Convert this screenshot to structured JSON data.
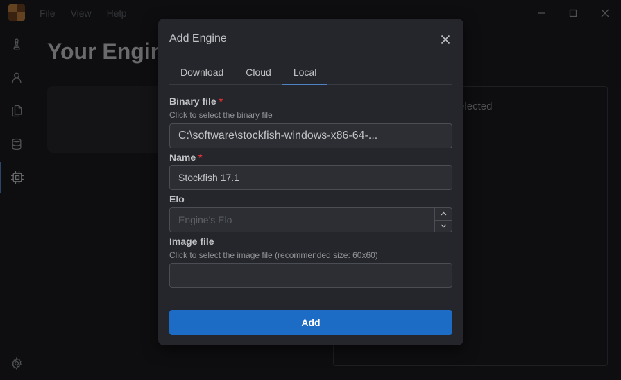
{
  "menu": {
    "items": [
      "File",
      "View",
      "Help"
    ]
  },
  "main": {
    "title": "Your Engines",
    "right_panel_text": "No engine selected"
  },
  "modal": {
    "title": "Add Engine",
    "tabs": [
      {
        "label": "Download",
        "active": false
      },
      {
        "label": "Cloud",
        "active": false
      },
      {
        "label": "Local",
        "active": true
      }
    ],
    "binary": {
      "label": "Binary file",
      "required_mark": "*",
      "description": "Click to select the binary file",
      "value": "C:\\software\\stockfish-windows-x86-64-..."
    },
    "name": {
      "label": "Name",
      "required_mark": "*",
      "value": "Stockfish 17.1"
    },
    "elo": {
      "label": "Elo",
      "placeholder": "Engine's Elo"
    },
    "image": {
      "label": "Image file",
      "description": "Click to select the image file (recommended size: 60x60)",
      "value": ""
    },
    "submit_label": "Add"
  },
  "sidebar": {
    "icons": [
      "chess-pawn-icon",
      "user-icon",
      "files-icon",
      "database-icon",
      "cpu-icon",
      "settings-icon"
    ],
    "active_index": 4
  },
  "colors": {
    "accent": "#1c6bc4",
    "tab_indicator": "#4d82c4",
    "required": "#e03131",
    "background": "#1a1b1e",
    "modal": "#25262b"
  }
}
